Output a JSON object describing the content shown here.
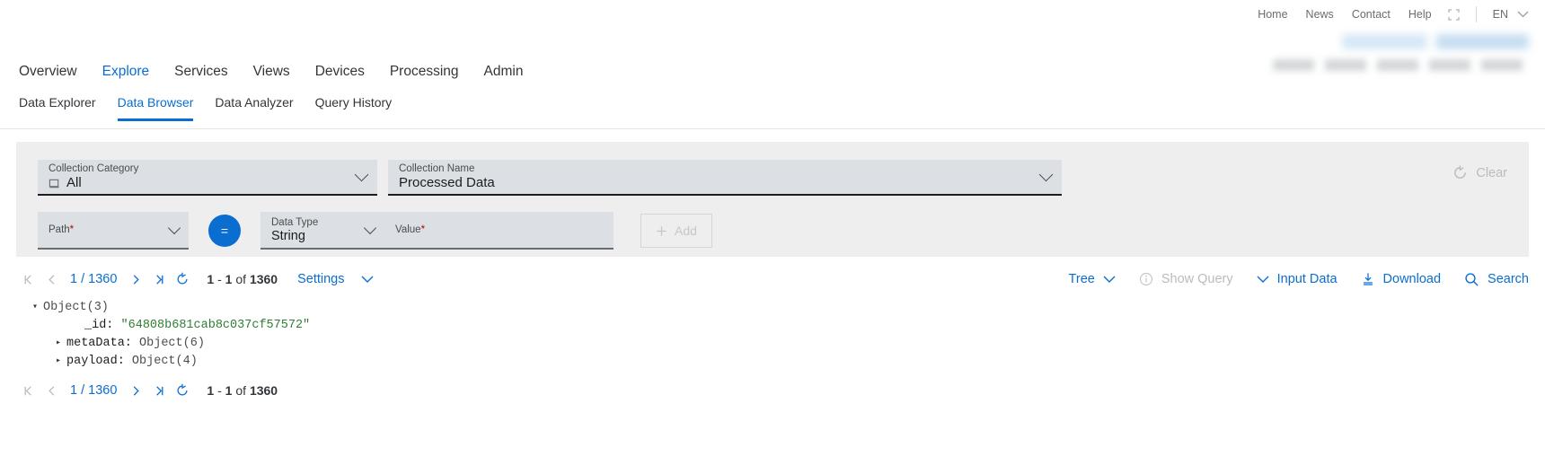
{
  "utility_bar": {
    "links": [
      "Home",
      "News",
      "Contact",
      "Help"
    ],
    "fullscreen_icon": "fullscreen-icon",
    "language": "EN"
  },
  "main_nav": {
    "items": [
      "Overview",
      "Explore",
      "Services",
      "Views",
      "Devices",
      "Processing",
      "Admin"
    ],
    "active": "Explore"
  },
  "sub_nav": {
    "items": [
      "Data Explorer",
      "Data Browser",
      "Data Analyzer",
      "Query History"
    ],
    "active": "Data Browser"
  },
  "filters": {
    "collection_category": {
      "label": "Collection Category",
      "value": "All",
      "icon": "collection-icon"
    },
    "collection_name": {
      "label": "Collection Name",
      "value": "Processed Data"
    },
    "clear_button": {
      "label": "Clear",
      "icon": "reset-icon"
    },
    "query_row": {
      "path": {
        "label": "Path",
        "required": "*",
        "value": ""
      },
      "operator": "=",
      "data_type": {
        "label": "Data Type",
        "value": "String"
      },
      "value_field": {
        "label": "Value",
        "required": "*",
        "value": ""
      },
      "add_button": {
        "label": "Add",
        "icon": "plus-icon"
      }
    }
  },
  "toolbar": {
    "page_indicator": "1 / 1360",
    "range_from": "1",
    "range_sep": "-",
    "range_to": "1",
    "range_of": "of",
    "range_total": "1360",
    "settings_label": "Settings",
    "view_mode": "Tree",
    "show_query": "Show Query",
    "input_data": "Input Data",
    "download": "Download",
    "search": "Search"
  },
  "tree": {
    "root_label": "Object(3)",
    "rows": [
      {
        "key": "_id:",
        "value": "\"64808b681cab8c037cf57572\"",
        "type": "string",
        "expandable": false
      },
      {
        "key": "metaData:",
        "value": "Object(6)",
        "type": "object",
        "expandable": true
      },
      {
        "key": "payload:",
        "value": "Object(4)",
        "type": "object",
        "expandable": true
      }
    ]
  },
  "bottom_toolbar": {
    "page_indicator": "1 / 1360",
    "range_from": "1",
    "range_sep": "-",
    "range_to": "1",
    "range_of": "of",
    "range_total": "1360"
  },
  "colors": {
    "accent": "#0a6ed1",
    "text": "#32363a",
    "muted": "#6a6d70",
    "disabled": "#b9bcbf",
    "panel": "#eeeeee",
    "field": "#dcdfe3",
    "string_green": "#2f7d32",
    "required_red": "#bb0000"
  }
}
